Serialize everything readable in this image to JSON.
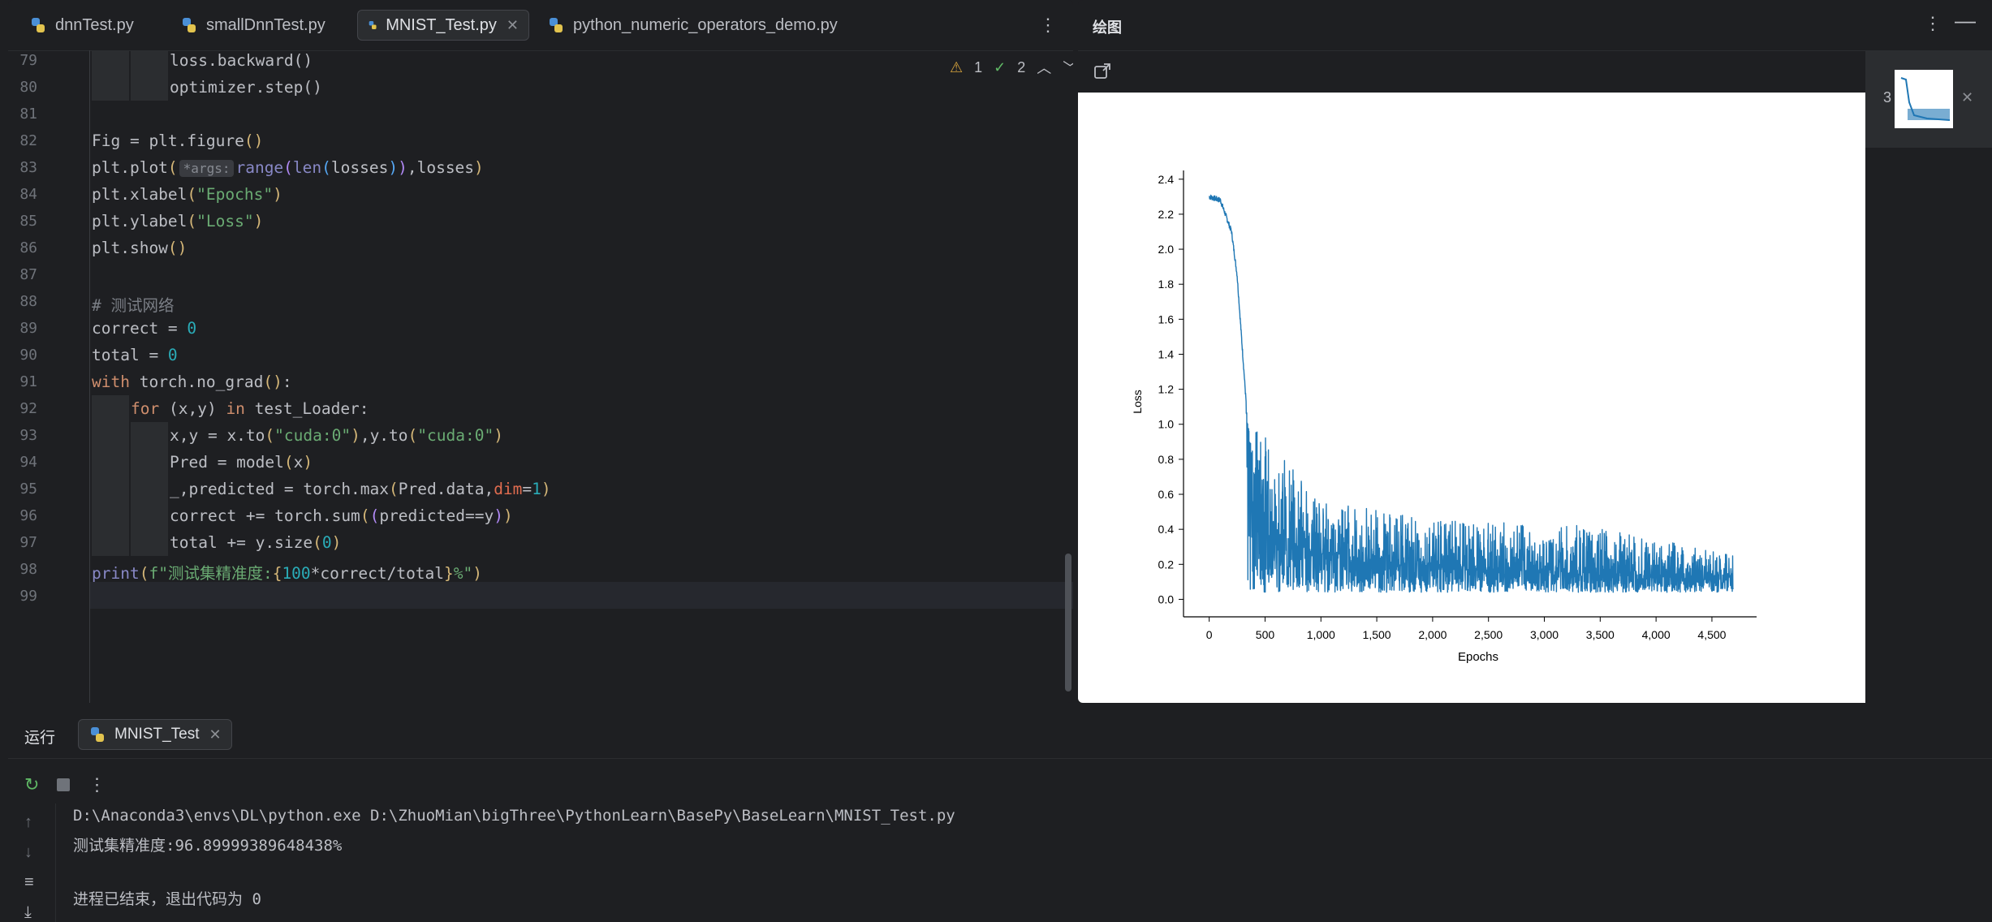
{
  "tabs": [
    {
      "label": "dnnTest.py",
      "active": false
    },
    {
      "label": "smallDnnTest.py",
      "active": false
    },
    {
      "label": "MNIST_Test.py",
      "active": true
    },
    {
      "label": "python_numeric_operators_demo.py",
      "active": false
    }
  ],
  "inspections": {
    "warnings": "1",
    "weak": "2"
  },
  "line_numbers": [
    "79",
    "80",
    "81",
    "82",
    "83",
    "84",
    "85",
    "86",
    "87",
    "88",
    "89",
    "90",
    "91",
    "92",
    "93",
    "94",
    "95",
    "96",
    "97",
    "98",
    "99"
  ],
  "code": {
    "l79": "loss.backward()",
    "l80": "optimizer.step()",
    "l82_a": "Fig = plt.figure",
    "l83_a": "plt.plot",
    "l83_hint": "*args:",
    "l83_b": "range",
    "l83_c": "len",
    "l83_d": "losses",
    "l83_e": ",losses",
    "l84_a": "plt.xlabel",
    "l84_s": "\"Epochs\"",
    "l85_a": "plt.ylabel",
    "l85_s": "\"Loss\"",
    "l86_a": "plt.show",
    "l88": "# 测试网络",
    "l89_a": "correct = ",
    "l89_n": "0",
    "l90_a": "total = ",
    "l90_n": "0",
    "l91_kw": "with",
    "l91_a": " torch.no_grad",
    "l91_b": ":",
    "l92_kw": "for",
    "l92_a": "(x,y)",
    "l92_kw2": "in",
    "l92_b": " test_Loader:",
    "l93_a": "x,y = x.to",
    "l93_s1": "\"cuda:0\"",
    "l93_b": ",y.to",
    "l93_s2": "\"cuda:0\"",
    "l94_a": "Pred = model",
    "l94_b": "x",
    "l95_a": "_,predicted = torch.max",
    "l95_b": "Pred.data,",
    "l95_p": "dim",
    "l95_eq": "=",
    "l95_n": "1",
    "l96_a": "correct += torch.sum",
    "l96_b": "predicted==y",
    "l97_a": "total += y.size",
    "l97_n": "0",
    "l98_fn": "print",
    "l98_f": "f\"",
    "l98_s": "测试集精准度:",
    "l98_e1": "{",
    "l98_n": "100",
    "l98_e": "*correct/total",
    "l98_e2": "}",
    "l98_end": "%\""
  },
  "plot_panel": {
    "title": "绘图",
    "thumb_index": "3"
  },
  "chart_data": {
    "type": "line",
    "xlabel": "Epochs",
    "ylabel": "Loss",
    "xlim": [
      -230,
      4900
    ],
    "ylim": [
      -0.1,
      2.45
    ],
    "x_ticks": [
      "0",
      "500",
      "1,000",
      "1,500",
      "2,000",
      "2,500",
      "3,000",
      "3,500",
      "4,000",
      "4,500"
    ],
    "x_tick_values": [
      0,
      500,
      1000,
      1500,
      2000,
      2500,
      3000,
      3500,
      4000,
      4500
    ],
    "y_ticks": [
      "0.0",
      "0.2",
      "0.4",
      "0.6",
      "0.8",
      "1.0",
      "1.2",
      "1.4",
      "1.6",
      "1.8",
      "2.0",
      "2.2",
      "2.4"
    ],
    "y_tick_values": [
      0.0,
      0.2,
      0.4,
      0.6,
      0.8,
      1.0,
      1.2,
      1.4,
      1.6,
      1.8,
      2.0,
      2.2,
      2.4
    ],
    "series_color": "#1f77b4",
    "trend": {
      "x": [
        0,
        100,
        200,
        250,
        300,
        350,
        400,
        500,
        600,
        800,
        1000,
        1500,
        2000,
        2500,
        3000,
        3500,
        4000,
        4500,
        4690
      ],
      "y": [
        2.3,
        2.28,
        2.1,
        1.85,
        1.4,
        0.95,
        0.72,
        0.48,
        0.38,
        0.3,
        0.26,
        0.22,
        0.19,
        0.17,
        0.16,
        0.15,
        0.14,
        0.13,
        0.13
      ]
    },
    "spread_low": 0.04,
    "spread_high": [
      {
        "x": 400,
        "y": 1.0
      },
      {
        "x": 1000,
        "y": 0.58
      },
      {
        "x": 2000,
        "y": 0.45
      },
      {
        "x": 3500,
        "y": 0.42
      },
      {
        "x": 4690,
        "y": 0.25
      }
    ]
  },
  "run": {
    "label": "运行",
    "tab": "MNIST_Test",
    "output": [
      "D:\\Anaconda3\\envs\\DL\\python.exe D:\\ZhuoMian\\bigThree\\PythonLearn\\BasePy\\BaseLearn\\MNIST_Test.py",
      "测试集精准度:96.89999389648438%",
      "",
      "进程已结束，退出代码为 0"
    ]
  }
}
